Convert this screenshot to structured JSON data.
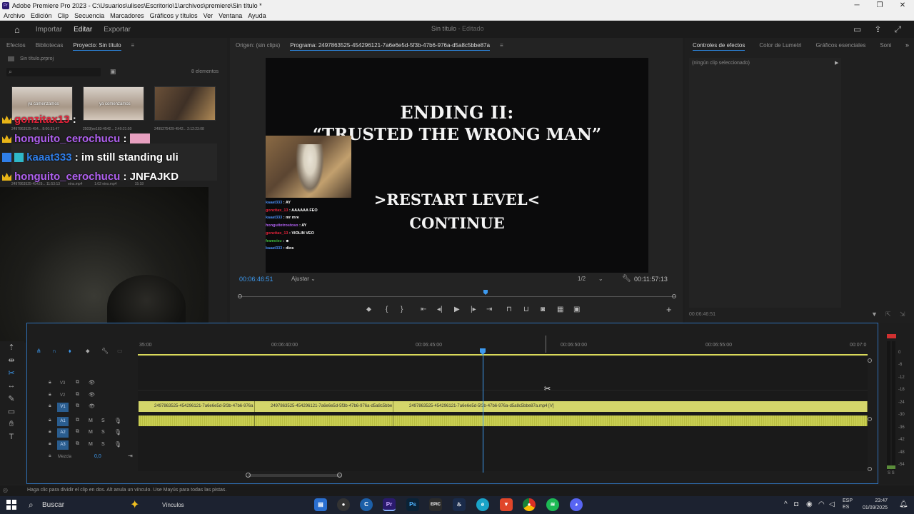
{
  "window": {
    "title": "Adobe Premiere Pro 2023 - C:\\Usuarios\\ulises\\Escritorio\\1\\archivos\\premiere\\Sin título *"
  },
  "menu": [
    "Archivo",
    "Edición",
    "Clip",
    "Secuencia",
    "Marcadores",
    "Gráficos y títulos",
    "Ver",
    "Ventana",
    "Ayuda"
  ],
  "header": {
    "workspaces": [
      "Importar",
      "Editar",
      "Exportar"
    ],
    "active": "Editar",
    "project_title": "Sin título",
    "project_state": "- Editado"
  },
  "left_panel": {
    "tabs": [
      "Efectos",
      "Bibliotecas",
      "Proyecto: Sin título"
    ],
    "project_file": "Sin título.prproj",
    "item_count": "8 elementos",
    "thumbs": [
      {
        "caption": "2497863525-454...",
        "duration": "8:00:31:47",
        "overlay": "ya comenzamos"
      },
      {
        "caption": "2503[ee183-4542...",
        "duration": "2:40:21:50",
        "overlay": "ya comenzamos"
      },
      {
        "caption": "2495275429-4542...",
        "duration": "2:12:23:08",
        "overlay": ""
      }
    ],
    "bottom_captions": [
      "2497863525-45429...",
      "11:53:13",
      "eins.mp4",
      "1:02",
      "eins.mp4",
      "15:18"
    ]
  },
  "chat_overlay": [
    {
      "user": "gonzitax13",
      "msg": ":",
      "color": "#e8233b"
    },
    {
      "user": "honguito_cerochucu",
      "msg": ":",
      "color": "#b060f0"
    },
    {
      "user": "kaaat333",
      "msg": ": im still standing uli",
      "color": "#2f7ee8"
    },
    {
      "user": "honguito_cerochucu",
      "msg": ": JNFAJKD",
      "color": "#b060f0"
    }
  ],
  "source_tab": "Origen: (sin clips)",
  "program": {
    "tab": "Programa: 2497863525-454296121-7a6e6e5d-5f3b-47b6-976a-d5a8c5bbe87a",
    "title_line1": "ENDING II:",
    "title_line2": "“TRUSTED THE WRONG MAN”",
    "option1": ">RESTART LEVEL<",
    "option2": "CONTINUE",
    "timecode": "00:06:46:51",
    "fit": "Ajustar",
    "resolution": "1/2",
    "duration": "00:11:57:13",
    "playhead_fraction": 0.565,
    "mini_chat": [
      {
        "user": "kaaat333",
        "msg": ": AY",
        "color": "#4a8cf0"
      },
      {
        "user": "gonzitax_13",
        "msg": ": AAAAAA FEO",
        "color": "#e8233b"
      },
      {
        "user": "kaaat333",
        "msg": ": mr mre",
        "color": "#4a8cf0"
      },
      {
        "user": "honguitotrostoso",
        "msg": ": AY",
        "color": "#b060f0"
      },
      {
        "user": "gonzitax_13",
        "msg": ": VIOLIN VEO",
        "color": "#e8233b"
      },
      {
        "user": "framoiez",
        "msg": ": ☻",
        "color": "#3fbf3f"
      },
      {
        "user": "kaaat333",
        "msg": ": dios",
        "color": "#4a8cf0"
      }
    ]
  },
  "right_panel": {
    "tabs": [
      "Controles de efectos",
      "Color de Lumetri",
      "Gráficos esenciales",
      "Soni"
    ],
    "empty_text": "(ningún clip seleccionado)",
    "timecode": "00:06:46:51"
  },
  "timeline": {
    "ruler": [
      "35:00",
      "00:06:40:00",
      "00:06:45:00",
      "00:06:50:00",
      "00:06:55:00",
      "00:07:0"
    ],
    "tracks_video": [
      "V3",
      "V2",
      "V1"
    ],
    "tracks_audio": [
      "A1",
      "A2",
      "A3"
    ],
    "mix_label": "Mezcla",
    "mix_value": "0,0",
    "track_letters": [
      "M",
      "S"
    ],
    "clips": [
      "2497863525-454296121-7a6e6e5d-5f3b-47b6-976a",
      "2497863525-454296121-7a6e6e5d-5f3b-47b6-976a-d5a8c5bbe",
      "2497863525-454296121-7a6e6e5d-5f3b-47b6-976a-d5a8c5bbe87a.mp4 [V]"
    ]
  },
  "meter_labels": [
    "0",
    "-6",
    "-12",
    "-18",
    "-24",
    "-30",
    "-36",
    "-42",
    "-48",
    "-54",
    "S S"
  ],
  "status_bar": "Haga clic para dividir el clip en dos. Alt anula un vínculo. Use Mayús para todas las pistas.",
  "taskbar": {
    "search": "Buscar",
    "widget": "Vínculos",
    "lang1": "ESP",
    "lang2": "ES",
    "time": "23:47",
    "date": "01/09/2025"
  }
}
